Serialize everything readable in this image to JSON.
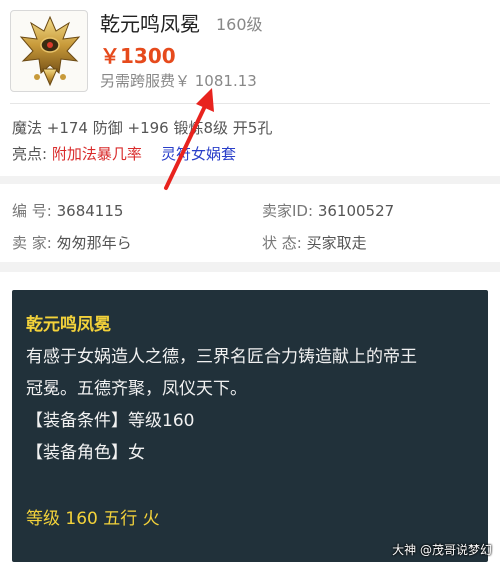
{
  "item": {
    "name": "乾元鸣凤冕",
    "level": "160级",
    "price": "￥1300",
    "cross_server_fee": "另需跨服费￥ 1081.13"
  },
  "attributes": {
    "line": "魔法 +174 防御 +196 锻炼8级 开5孔",
    "highlight_label": "亮点:",
    "highlight_1": "附加法暴几率",
    "highlight_2": "灵符女娲套"
  },
  "info": {
    "code_label": "编  号:",
    "code_value": "3684115",
    "seller_id_label": "卖家ID:",
    "seller_id_value": "36100527",
    "seller_label": "卖  家:",
    "seller_value": "匆匆那年ら",
    "status_label": "状  态:",
    "status_value": "买家取走"
  },
  "desc": {
    "title": "乾元鸣凤冕",
    "line1": "有感于女娲造人之德，三界名匠合力铸造献上的帝王",
    "line2": "冠冕。五德齐聚，凤仪天下。",
    "line3": "【装备条件】等级160",
    "line4": "【装备角色】女",
    "footer": "等级 160 五行 火"
  },
  "watermark": "大神 @茂哥说梦幻",
  "colors": {
    "price": "#e64a1c",
    "highlight_red": "#d92c2c",
    "highlight_blue": "#2a3fc9",
    "panel_bg": "#21313a",
    "panel_accent": "#f3d23a",
    "annotation_arrow": "#e8231e"
  }
}
